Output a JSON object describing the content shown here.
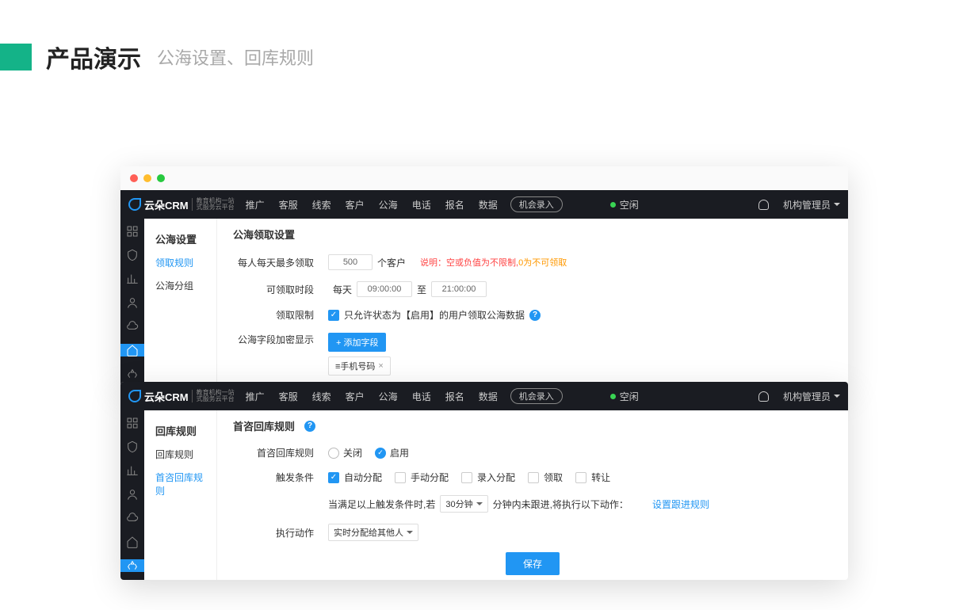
{
  "slide": {
    "title": "产品演示",
    "sub": "公海设置、回库规则"
  },
  "logo": {
    "brand": "云朵CRM",
    "sub1": "教育机构一站",
    "sub2": "式服务云平台"
  },
  "nav": {
    "items": [
      "推广",
      "客服",
      "线索",
      "客户",
      "公海",
      "电话",
      "报名",
      "数据"
    ],
    "record_btn": "机会录入",
    "status": "空闲",
    "user": "机构管理员"
  },
  "win1": {
    "side_title": "公海设置",
    "side_items": [
      "领取规则",
      "公海分组"
    ],
    "content_title": "公海领取设置",
    "row1": {
      "label": "每人每天最多领取",
      "value": "500",
      "unit": "个客户",
      "note_prefix": "说明：",
      "note1": "空或负值为不限制,",
      "note2": "0为不可领取"
    },
    "row2": {
      "label": "可领取时段",
      "daily": "每天",
      "from": "09:00:00",
      "to_label": "至",
      "to": "21:00:00"
    },
    "row3": {
      "label": "领取限制",
      "check_text": "只允许状态为【启用】的用户领取公海数据"
    },
    "row4": {
      "label": "公海字段加密显示",
      "btn": "+ 添加字段",
      "tag": "≡手机号码"
    }
  },
  "win2": {
    "side_title": "回库规则",
    "side_items": [
      "回库规则",
      "首咨回库规则"
    ],
    "content_title": "首咨回库规则",
    "row1": {
      "label": "首咨回库规则",
      "off": "关闭",
      "on": "启用"
    },
    "row2": {
      "label": "触发条件",
      "opts": [
        "自动分配",
        "手动分配",
        "录入分配",
        "领取",
        "转让"
      ]
    },
    "row3": {
      "pre": "当满足以上触发条件时,若",
      "sel": "30分钟",
      "post": "分钟内未跟进,将执行以下动作：",
      "link": "设置跟进规则"
    },
    "row4": {
      "label": "执行动作",
      "sel": "实时分配给其他人"
    },
    "save": "保存"
  }
}
